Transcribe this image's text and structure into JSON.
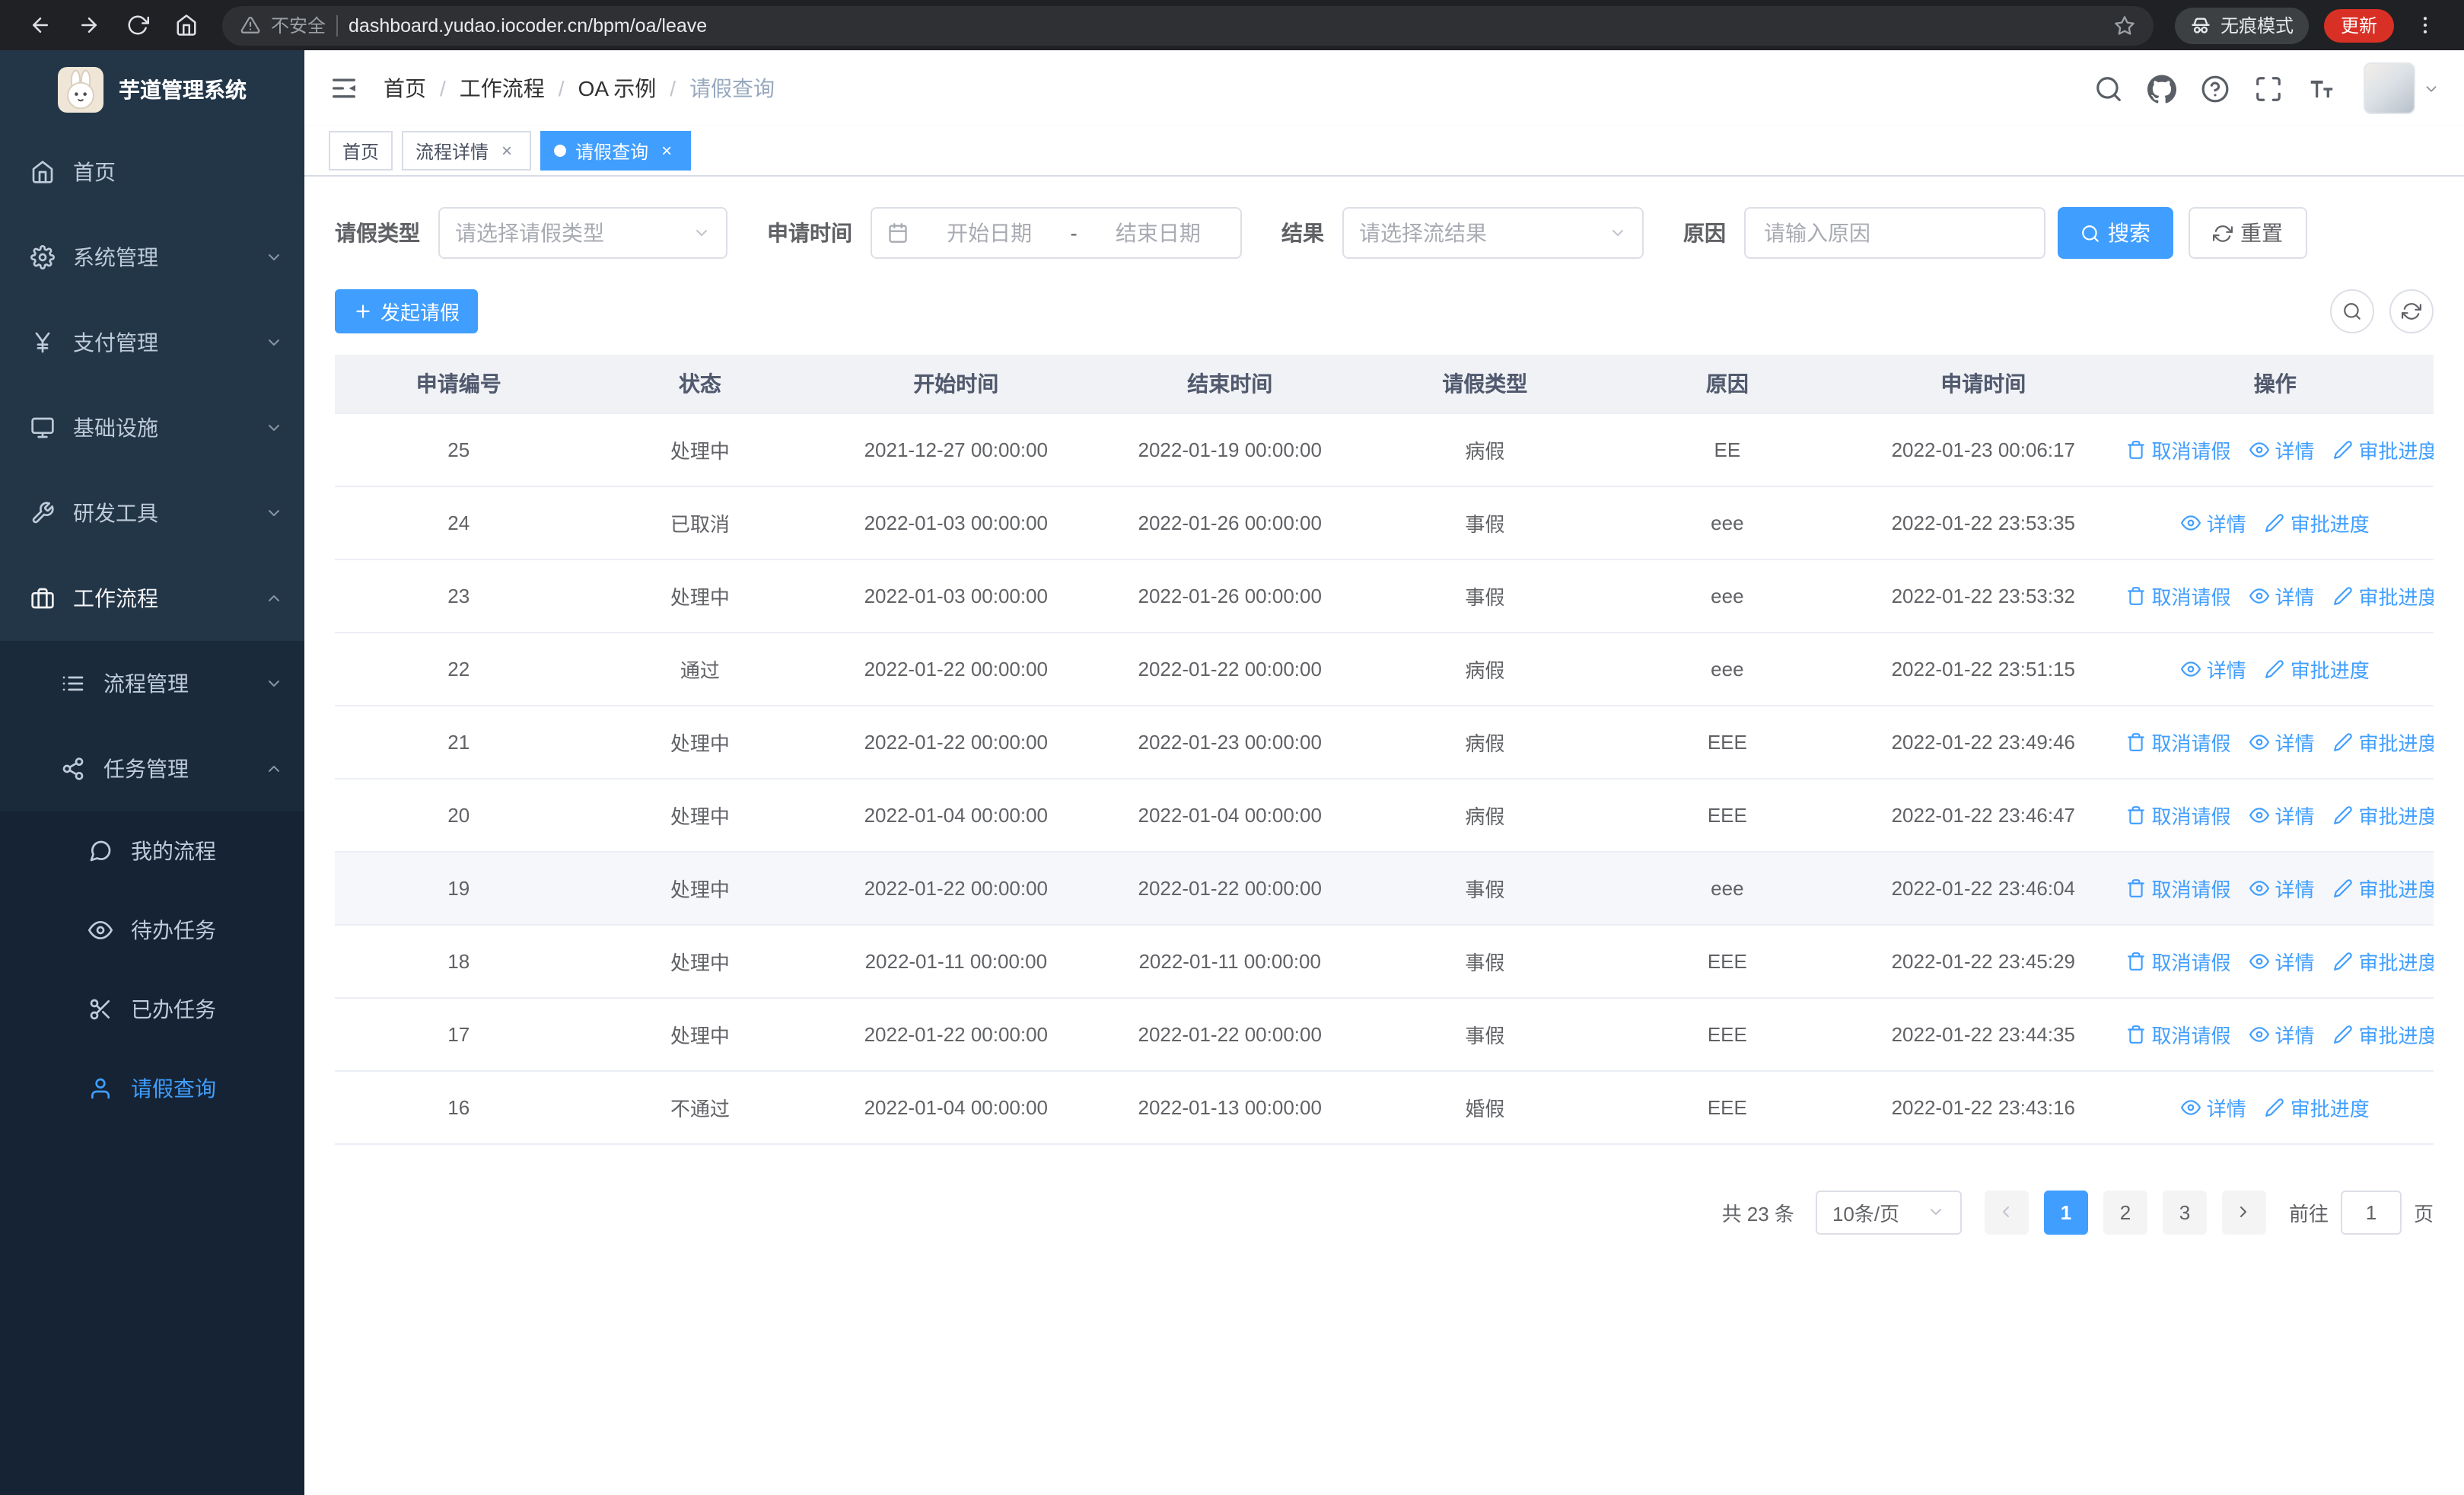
{
  "colors": {
    "primary": "#409eff",
    "sidebar_bg": "#233648",
    "sidebar_submenu_bg": "#1b2a3a",
    "sidebar_deep_bg": "#152334",
    "update_badge": "#d93025",
    "table_header_bg": "#f0f2f5"
  },
  "browser": {
    "security_label": "不安全",
    "url": "dashboard.yudao.iocoder.cn/bpm/oa/leave",
    "incognito_label": "无痕模式",
    "update_label": "更新"
  },
  "sidebar": {
    "logo_title": "芋道管理系统",
    "items": [
      {
        "key": "home",
        "label": "首页",
        "icon": "home",
        "level": 1
      },
      {
        "key": "system",
        "label": "系统管理",
        "icon": "gear",
        "level": 1,
        "chevron": "down"
      },
      {
        "key": "payment",
        "label": "支付管理",
        "icon": "yen",
        "level": 1,
        "chevron": "down"
      },
      {
        "key": "infrastructure",
        "label": "基础设施",
        "icon": "monitor",
        "level": 1,
        "chevron": "down"
      },
      {
        "key": "devtools",
        "label": "研发工具",
        "icon": "tool",
        "level": 1,
        "chevron": "down"
      },
      {
        "key": "workflow",
        "label": "工作流程",
        "icon": "briefcase",
        "level": 1,
        "chevron": "up",
        "open": true
      },
      {
        "key": "process-mgmt",
        "label": "流程管理",
        "icon": "list",
        "level": 2,
        "chevron": "down"
      },
      {
        "key": "task-mgmt",
        "label": "任务管理",
        "icon": "share",
        "level": 2,
        "chevron": "up"
      },
      {
        "key": "my-process",
        "label": "我的流程",
        "icon": "message",
        "level": 3
      },
      {
        "key": "todo-task",
        "label": "待办任务",
        "icon": "eye",
        "level": 3
      },
      {
        "key": "done-task",
        "label": "已办任务",
        "icon": "scissors",
        "level": 3
      },
      {
        "key": "leave-query",
        "label": "请假查询",
        "icon": "user",
        "level": 3,
        "active": true
      }
    ]
  },
  "header": {
    "breadcrumb": [
      "首页",
      "工作流程",
      "OA 示例",
      "请假查询"
    ]
  },
  "tabs": [
    {
      "label": "首页",
      "closable": false,
      "active": false
    },
    {
      "label": "流程详情",
      "closable": true,
      "active": false
    },
    {
      "label": "请假查询",
      "closable": true,
      "active": true
    }
  ],
  "filters": {
    "leave_type_label": "请假类型",
    "leave_type_placeholder": "请选择请假类型",
    "apply_time_label": "申请时间",
    "start_date_placeholder": "开始日期",
    "range_separator": "-",
    "end_date_placeholder": "结束日期",
    "result_label": "结果",
    "result_placeholder": "请选择流结果",
    "reason_label": "原因",
    "reason_placeholder": "请输入原因",
    "search_label": "搜索",
    "reset_label": "重置"
  },
  "toolbar": {
    "create_label": "发起请假"
  },
  "table": {
    "columns": [
      "申请编号",
      "状态",
      "开始时间",
      "结束时间",
      "请假类型",
      "原因",
      "申请时间",
      "操作"
    ],
    "action_labels": {
      "cancel": "取消请假",
      "detail": "详情",
      "progress": "审批进度"
    },
    "rows": [
      {
        "id": "25",
        "status": "处理中",
        "start": "2021-12-27 00:00:00",
        "end": "2022-01-19 00:00:00",
        "type": "病假",
        "reason": "EE",
        "apply_time": "2022-01-23 00:06:17",
        "actions": [
          "cancel",
          "detail",
          "progress"
        ]
      },
      {
        "id": "24",
        "status": "已取消",
        "start": "2022-01-03 00:00:00",
        "end": "2022-01-26 00:00:00",
        "type": "事假",
        "reason": "eee",
        "apply_time": "2022-01-22 23:53:35",
        "actions": [
          "detail",
          "progress"
        ]
      },
      {
        "id": "23",
        "status": "处理中",
        "start": "2022-01-03 00:00:00",
        "end": "2022-01-26 00:00:00",
        "type": "事假",
        "reason": "eee",
        "apply_time": "2022-01-22 23:53:32",
        "actions": [
          "cancel",
          "detail",
          "progress"
        ]
      },
      {
        "id": "22",
        "status": "通过",
        "start": "2022-01-22 00:00:00",
        "end": "2022-01-22 00:00:00",
        "type": "病假",
        "reason": "eee",
        "apply_time": "2022-01-22 23:51:15",
        "actions": [
          "detail",
          "progress"
        ]
      },
      {
        "id": "21",
        "status": "处理中",
        "start": "2022-01-22 00:00:00",
        "end": "2022-01-23 00:00:00",
        "type": "病假",
        "reason": "EEE",
        "apply_time": "2022-01-22 23:49:46",
        "actions": [
          "cancel",
          "detail",
          "progress"
        ]
      },
      {
        "id": "20",
        "status": "处理中",
        "start": "2022-01-04 00:00:00",
        "end": "2022-01-04 00:00:00",
        "type": "病假",
        "reason": "EEE",
        "apply_time": "2022-01-22 23:46:47",
        "actions": [
          "cancel",
          "detail",
          "progress"
        ]
      },
      {
        "id": "19",
        "status": "处理中",
        "start": "2022-01-22 00:00:00",
        "end": "2022-01-22 00:00:00",
        "type": "事假",
        "reason": "eee",
        "apply_time": "2022-01-22 23:46:04",
        "actions": [
          "cancel",
          "detail",
          "progress"
        ],
        "highlighted": true
      },
      {
        "id": "18",
        "status": "处理中",
        "start": "2022-01-11 00:00:00",
        "end": "2022-01-11 00:00:00",
        "type": "事假",
        "reason": "EEE",
        "apply_time": "2022-01-22 23:45:29",
        "actions": [
          "cancel",
          "detail",
          "progress"
        ]
      },
      {
        "id": "17",
        "status": "处理中",
        "start": "2022-01-22 00:00:00",
        "end": "2022-01-22 00:00:00",
        "type": "事假",
        "reason": "EEE",
        "apply_time": "2022-01-22 23:44:35",
        "actions": [
          "cancel",
          "detail",
          "progress"
        ]
      },
      {
        "id": "16",
        "status": "不通过",
        "start": "2022-01-04 00:00:00",
        "end": "2022-01-13 00:00:00",
        "type": "婚假",
        "reason": "EEE",
        "apply_time": "2022-01-22 23:43:16",
        "actions": [
          "detail",
          "progress"
        ]
      }
    ]
  },
  "pagination": {
    "total_text": "共 23 条",
    "page_size_label": "10条/页",
    "pages": [
      "1",
      "2",
      "3"
    ],
    "active_page": "1",
    "goto_label": "前往",
    "goto_value": "1",
    "unit_label": "页"
  }
}
